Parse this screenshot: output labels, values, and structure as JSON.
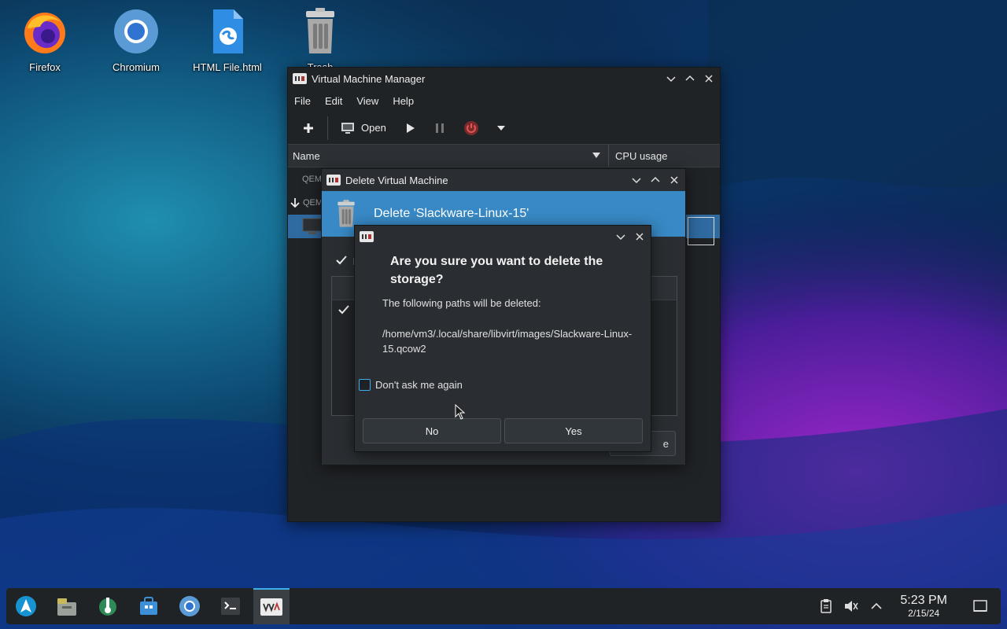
{
  "desktop": {
    "icons": [
      {
        "label": "Firefox",
        "icon": "firefox-icon"
      },
      {
        "label": "Chromium",
        "icon": "chromium-icon"
      },
      {
        "label": "HTML File.html",
        "icon": "html-file-icon"
      },
      {
        "label": "Trash",
        "icon": "trash-icon"
      }
    ]
  },
  "vmm": {
    "title": "Virtual Machine Manager",
    "menu": [
      "File",
      "Edit",
      "View",
      "Help"
    ],
    "toolbar": {
      "open_label": "Open"
    },
    "columns": {
      "name": "Name",
      "cpu": "CPU usage"
    },
    "rows": [
      {
        "label": "QEM"
      },
      {
        "label": "QEM"
      }
    ]
  },
  "delete_vm": {
    "title": "Delete Virtual Machine",
    "banner": "Delete 'Slackware-Linux-15'",
    "checkbox_label": "D",
    "button_label": "e"
  },
  "confirm": {
    "question": "Are you sure you want to delete the storage?",
    "subtitle": "The following paths will be deleted:",
    "path": "/home/vm3/.local/share/libvirt/images/Slackware-Linux-15.qcow2",
    "dont_ask": "Don't ask me again",
    "no_label": "No",
    "yes_label": "Yes"
  },
  "taskbar": {
    "time": "5:23 PM",
    "date": "2/15/24"
  },
  "colors": {
    "accent": "#3daee9",
    "banner": "#3889c5",
    "selection": "#2f6aa0"
  }
}
